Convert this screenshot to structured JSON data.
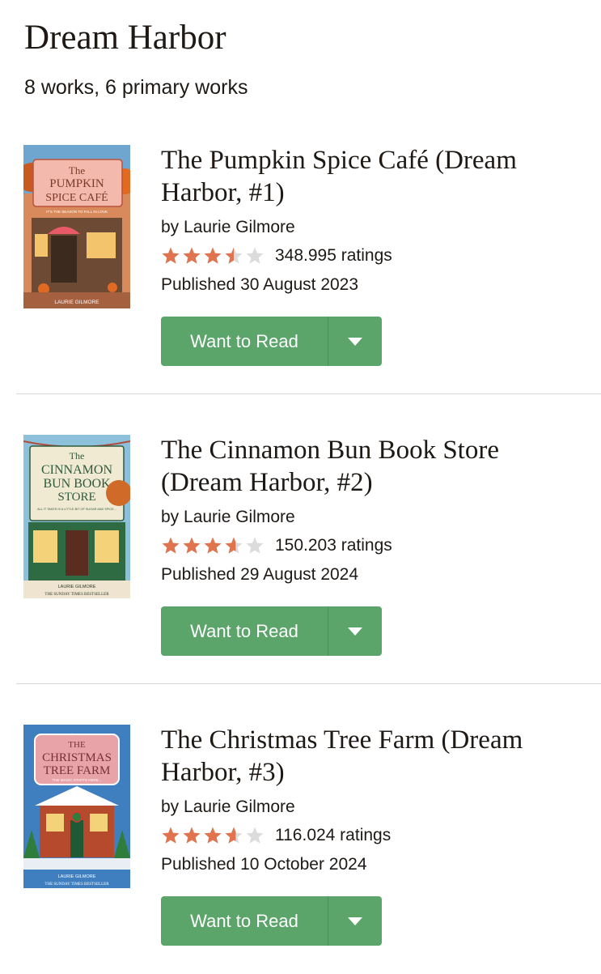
{
  "series": {
    "title": "Dream Harbor",
    "stats": "8 works, 6 primary works"
  },
  "books": [
    {
      "title": "The Pumpkin Spice Café (Dream Harbor, #1)",
      "author_line": "by Laurie Gilmore",
      "rating": 3.5,
      "ratings_count": "348.995 ratings",
      "published": "Published 30 August 2023",
      "button_label": "Want to Read",
      "dropdown_icon": "caret-down-icon",
      "cover": {
        "title_lines": [
          "The",
          "PUMPKIN",
          "SPICE CAFÉ"
        ],
        "tagline": "IT'S THE SEASON TO FALL IN LOVE",
        "author": "LAURIE GILMORE",
        "bg": "#e8875a",
        "accent": "#f5c4b8"
      }
    },
    {
      "title": "The Cinnamon Bun Book Store (Dream Harbor, #2)",
      "author_line": "by Laurie Gilmore",
      "rating": 3.6,
      "ratings_count": "150.203 ratings",
      "published": "Published 29 August 2024",
      "button_label": "Want to Read",
      "dropdown_icon": "caret-down-icon",
      "cover": {
        "title_lines": [
          "The",
          "CINNAMON",
          "BUN BOOK",
          "STORE"
        ],
        "tagline": "ALL IT TAKES IS A LITTLE BIT OF SUGAR AND SPICE...",
        "author": "LAURIE GILMORE",
        "bestseller": "THE SUNDAY TIMES BESTSELLER",
        "bg": "#7fb8d6",
        "accent": "#f2ead6"
      }
    },
    {
      "title": "The Christmas Tree Farm (Dream Harbor, #3)",
      "author_line": "by Laurie Gilmore",
      "rating": 3.6,
      "ratings_count": "116.024 ratings",
      "published": "Published 10 October 2024",
      "button_label": "Want to Read",
      "dropdown_icon": "caret-down-icon",
      "cover": {
        "title_lines": [
          "THE",
          "CHRISTMAS",
          "TREE FARM"
        ],
        "tagline": "THE MAGIC STARTS HERE...",
        "author": "LAURIE GILMORE",
        "bestseller": "THE SUNDAY TIMES BESTSELLER",
        "bg": "#3f7fc0",
        "accent": "#e8a0a6"
      }
    }
  ],
  "colors": {
    "star_filled": "#e0744f",
    "star_empty": "#dcdcdc",
    "button": "#5ba46a",
    "text": "#1e1915"
  }
}
